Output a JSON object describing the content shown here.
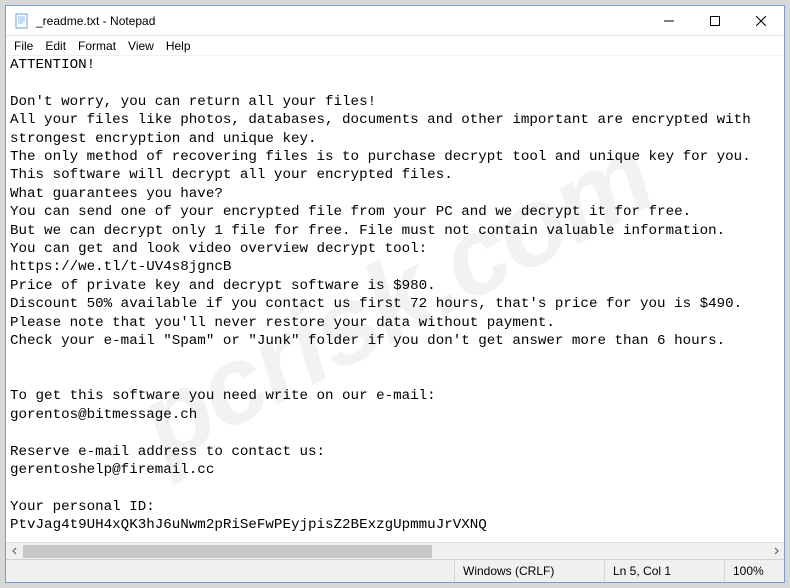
{
  "window": {
    "title": "_readme.txt - Notepad"
  },
  "menu": {
    "file": "File",
    "edit": "Edit",
    "format": "Format",
    "view": "View",
    "help": "Help"
  },
  "document": {
    "text": "ATTENTION!\n\nDon't worry, you can return all your files!\nAll your files like photos, databases, documents and other important are encrypted with strongest encryption and unique key.\nThe only method of recovering files is to purchase decrypt tool and unique key for you.\nThis software will decrypt all your encrypted files.\nWhat guarantees you have?\nYou can send one of your encrypted file from your PC and we decrypt it for free.\nBut we can decrypt only 1 file for free. File must not contain valuable information.\nYou can get and look video overview decrypt tool:\nhttps://we.tl/t-UV4s8jgncB\nPrice of private key and decrypt software is $980.\nDiscount 50% available if you contact us first 72 hours, that's price for you is $490.\nPlease note that you'll never restore your data without payment.\nCheck your e-mail \"Spam\" or \"Junk\" folder if you don't get answer more than 6 hours.\n\n\nTo get this software you need write on our e-mail:\ngorentos@bitmessage.ch\n\nReserve e-mail address to contact us:\ngerentoshelp@firemail.cc\n\nYour personal ID:\nPtvJag4t9UH4xQK3hJ6uNwm2pRiSeFwPEyjpisZ2BExzgUpmmuJrVXNQ"
  },
  "status": {
    "encoding": "Windows (CRLF)",
    "position": "Ln 5, Col 1",
    "zoom": "100%"
  },
  "watermark": "pcrisk.com"
}
